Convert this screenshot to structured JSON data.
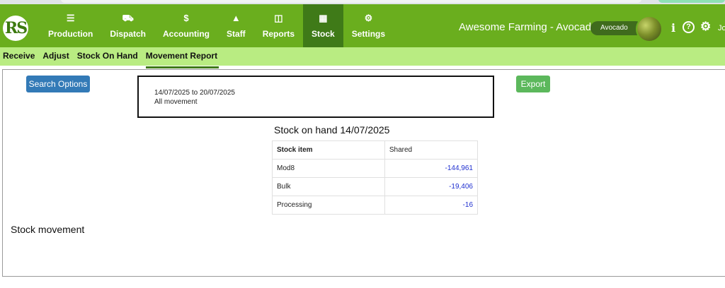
{
  "brand": {
    "logo_text": "RS"
  },
  "nav": {
    "items": [
      {
        "label": "Production",
        "icon": "users-icon",
        "glyph": "☰"
      },
      {
        "label": "Dispatch",
        "icon": "truck-icon",
        "glyph": "⛟"
      },
      {
        "label": "Accounting",
        "icon": "dollar-icon",
        "glyph": "$"
      },
      {
        "label": "Staff",
        "icon": "user-icon",
        "glyph": "▲"
      },
      {
        "label": "Reports",
        "icon": "columns-icon",
        "glyph": "◫"
      },
      {
        "label": "Stock",
        "icon": "grid-icon",
        "glyph": "▦",
        "active": true
      },
      {
        "label": "Settings",
        "icon": "gear-icon",
        "glyph": "⚙"
      }
    ]
  },
  "header": {
    "farm_title": "Awesome Farming - Avocados",
    "crop_selector": "Avocado",
    "info_glyph": "i",
    "help_glyph": "?",
    "settings_glyph": "⚙",
    "user_stub": "Jo"
  },
  "subnav": {
    "items": [
      {
        "label": "Receive"
      },
      {
        "label": "Adjust"
      },
      {
        "label": "Stock On Hand"
      },
      {
        "label": "Movement Report",
        "active": true
      }
    ]
  },
  "main": {
    "search_button": "Search Options",
    "export_button": "Export",
    "filter": {
      "date_range": "14/07/2025 to 20/07/2025",
      "movement_type": "All movement"
    },
    "stock_on_hand_title": "Stock on hand 14/07/2025",
    "table": {
      "headers": [
        "Stock item",
        "Shared"
      ],
      "rows": [
        {
          "item": "Mod8",
          "shared": "-144,961"
        },
        {
          "item": "Bulk",
          "shared": "-19,406"
        },
        {
          "item": "Processing",
          "shared": "-16"
        }
      ]
    },
    "movement_title": "Stock movement"
  },
  "colors": {
    "nav_green": "#6aae1e",
    "nav_active": "#3f7a18",
    "subnav_green": "#b9ec82",
    "search_blue": "#337ab7",
    "export_green": "#5cb85c",
    "negative_value_blue": "#1f2fd0"
  }
}
